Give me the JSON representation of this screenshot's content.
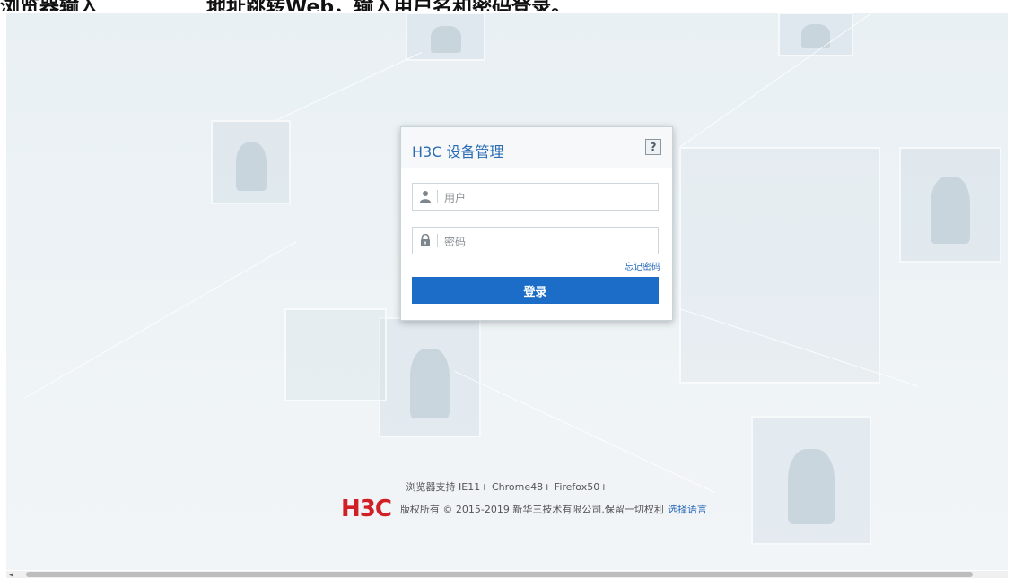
{
  "caption": {
    "left": "浏览器输入",
    "right": "地址跳转Web，输入用户名和密码登录。"
  },
  "dialog": {
    "title": "H3C 设备管理",
    "help_label": "?",
    "username_placeholder": "用户",
    "password_placeholder": "密码",
    "forgot_label": "忘记密码",
    "login_label": "登录",
    "icons": {
      "user": "user-icon",
      "lock": "lock-icon"
    }
  },
  "footer": {
    "browser_support": "浏览器支持 IE11+ Chrome48+ Firefox50+",
    "logo_text": "H3C",
    "copyright": "版权所有 © 2015-2019 新华三技术有限公司.保留一切权利",
    "language_link": "选择语言"
  },
  "colors": {
    "accent": "#1c6dc8",
    "title": "#2b6cb4",
    "brand": "#d11f26"
  }
}
